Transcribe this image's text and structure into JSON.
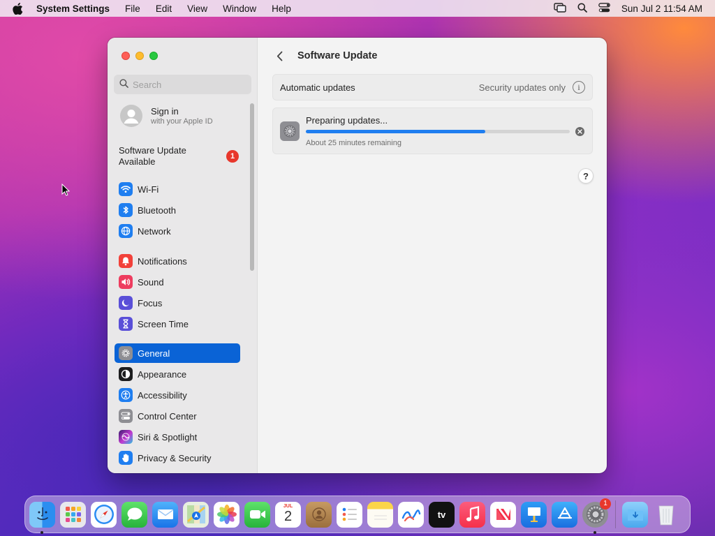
{
  "menubar": {
    "app_name": "System Settings",
    "menus": [
      "File",
      "Edit",
      "View",
      "Window",
      "Help"
    ],
    "clock": "Sun Jul 2  11:54 AM"
  },
  "sidebar": {
    "search_placeholder": "Search",
    "signin": {
      "title": "Sign in",
      "subtitle": "with your Apple ID"
    },
    "software_update": {
      "label": "Software Update Available",
      "badge": "1"
    },
    "items": [
      {
        "label": "Wi-Fi",
        "icon": "wifi-icon",
        "color": "#1f7ef0"
      },
      {
        "label": "Bluetooth",
        "icon": "bluetooth-icon",
        "color": "#1f7ef0"
      },
      {
        "label": "Network",
        "icon": "globe-icon",
        "color": "#1f7ef0"
      },
      {
        "label": "Notifications",
        "icon": "bell-icon",
        "color": "#f2413a"
      },
      {
        "label": "Sound",
        "icon": "speaker-icon",
        "color": "#ee3c5f"
      },
      {
        "label": "Focus",
        "icon": "moon-icon",
        "color": "#5a4fd8"
      },
      {
        "label": "Screen Time",
        "icon": "hourglass-icon",
        "color": "#5a4fd8"
      },
      {
        "label": "General",
        "icon": "gear-icon",
        "color": "#8e8e93",
        "active": true
      },
      {
        "label": "Appearance",
        "icon": "appearance-icon",
        "color": "#1c1c1e"
      },
      {
        "label": "Accessibility",
        "icon": "accessibility-icon",
        "color": "#1f7ef0"
      },
      {
        "label": "Control Center",
        "icon": "control-center-icon",
        "color": "#8e8e93"
      },
      {
        "label": "Siri & Spotlight",
        "icon": "siri-icon",
        "color": "#7a3fd0"
      },
      {
        "label": "Privacy & Security",
        "icon": "hand-icon",
        "color": "#1f7ef0"
      }
    ]
  },
  "main": {
    "title": "Software Update",
    "automatic_updates": {
      "label": "Automatic updates",
      "value": "Security updates only"
    },
    "progress": {
      "title": "Preparing updates...",
      "subtitle": "About 25 minutes remaining",
      "fraction": 0.68
    },
    "help": "?"
  },
  "dock": {
    "calendar_month": "JUL",
    "calendar_day": "2",
    "settings_badge": "1",
    "apps": [
      "Finder",
      "Launchpad",
      "Safari",
      "Messages",
      "Mail",
      "Maps",
      "Photos",
      "FaceTime",
      "Calendar",
      "Contacts",
      "Reminders",
      "Notes",
      "Freeform",
      "TV",
      "Music",
      "News",
      "Keynote",
      "App Store",
      "System Settings",
      "Downloads",
      "Trash"
    ],
    "tv_label": "tv"
  }
}
